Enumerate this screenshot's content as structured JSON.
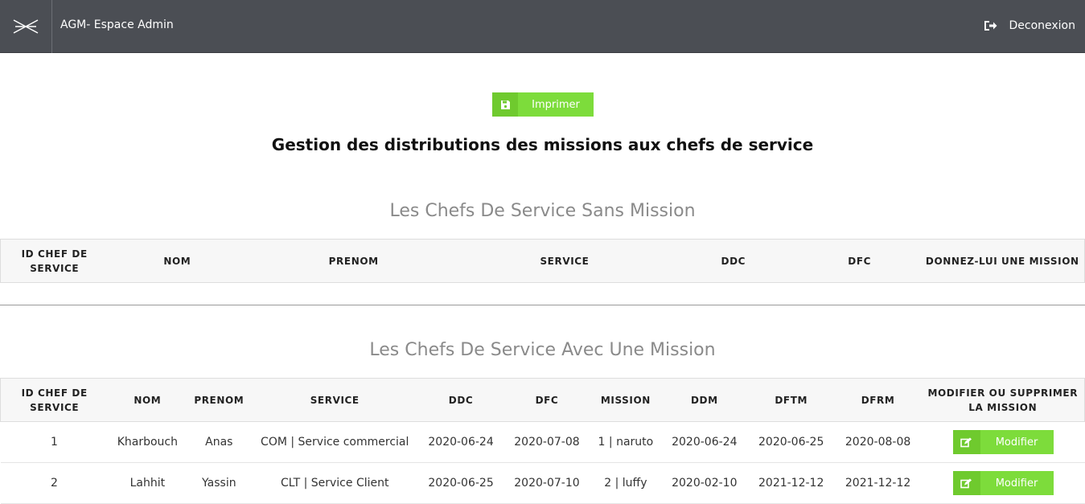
{
  "header": {
    "app_title": "AGM- Espace Admin",
    "logout_label": "Deconexion",
    "logo_icon": "crossed-lines-logo",
    "logout_icon": "sign-out-icon"
  },
  "actions": {
    "print_label": "Imprimer",
    "print_icon": "floppy-disk-icon"
  },
  "page_title": "Gestion des distributions des missions aux chefs de service",
  "without_mission": {
    "title": "Les Chefs De Service Sans Mission",
    "columns": [
      "ID CHEF DE SERVICE",
      "NOM",
      "PRENOM",
      "SERVICE",
      "DDC",
      "DFC",
      "DONNEZ-LUI UNE MISSION"
    ]
  },
  "with_mission": {
    "title": "Les Chefs De Service Avec Une Mission",
    "columns": [
      "ID CHEF DE SERVICE",
      "NOM",
      "PRENOM",
      "SERVICE",
      "DDC",
      "DFC",
      "MISSION",
      "DDM",
      "DFTM",
      "DFRM",
      "MODIFIER OU SUPPRIMER LA MISSION"
    ],
    "rows": [
      {
        "id": "1",
        "nom": "Kharbouch",
        "prenom": "Anas",
        "service": "COM | Service commercial",
        "ddc": "2020-06-24",
        "dfc": "2020-07-08",
        "mission": "1 | naruto",
        "ddm": "2020-06-24",
        "dftm": "2020-06-25",
        "dfrm": "2020-08-08",
        "action_label": "Modifier"
      },
      {
        "id": "2",
        "nom": "Lahhit",
        "prenom": "Yassin",
        "service": "CLT | Service Client",
        "ddc": "2020-06-25",
        "dfc": "2020-07-10",
        "mission": "2 | luffy",
        "ddm": "2020-02-10",
        "dftm": "2021-12-12",
        "dfrm": "2021-12-12",
        "action_label": "Modifier"
      }
    ]
  },
  "colors": {
    "header_bg": "#4b4e54",
    "button_green": "#7ddc3b",
    "button_green_dark": "#6fca2e",
    "section_title": "#8a8a8a"
  }
}
